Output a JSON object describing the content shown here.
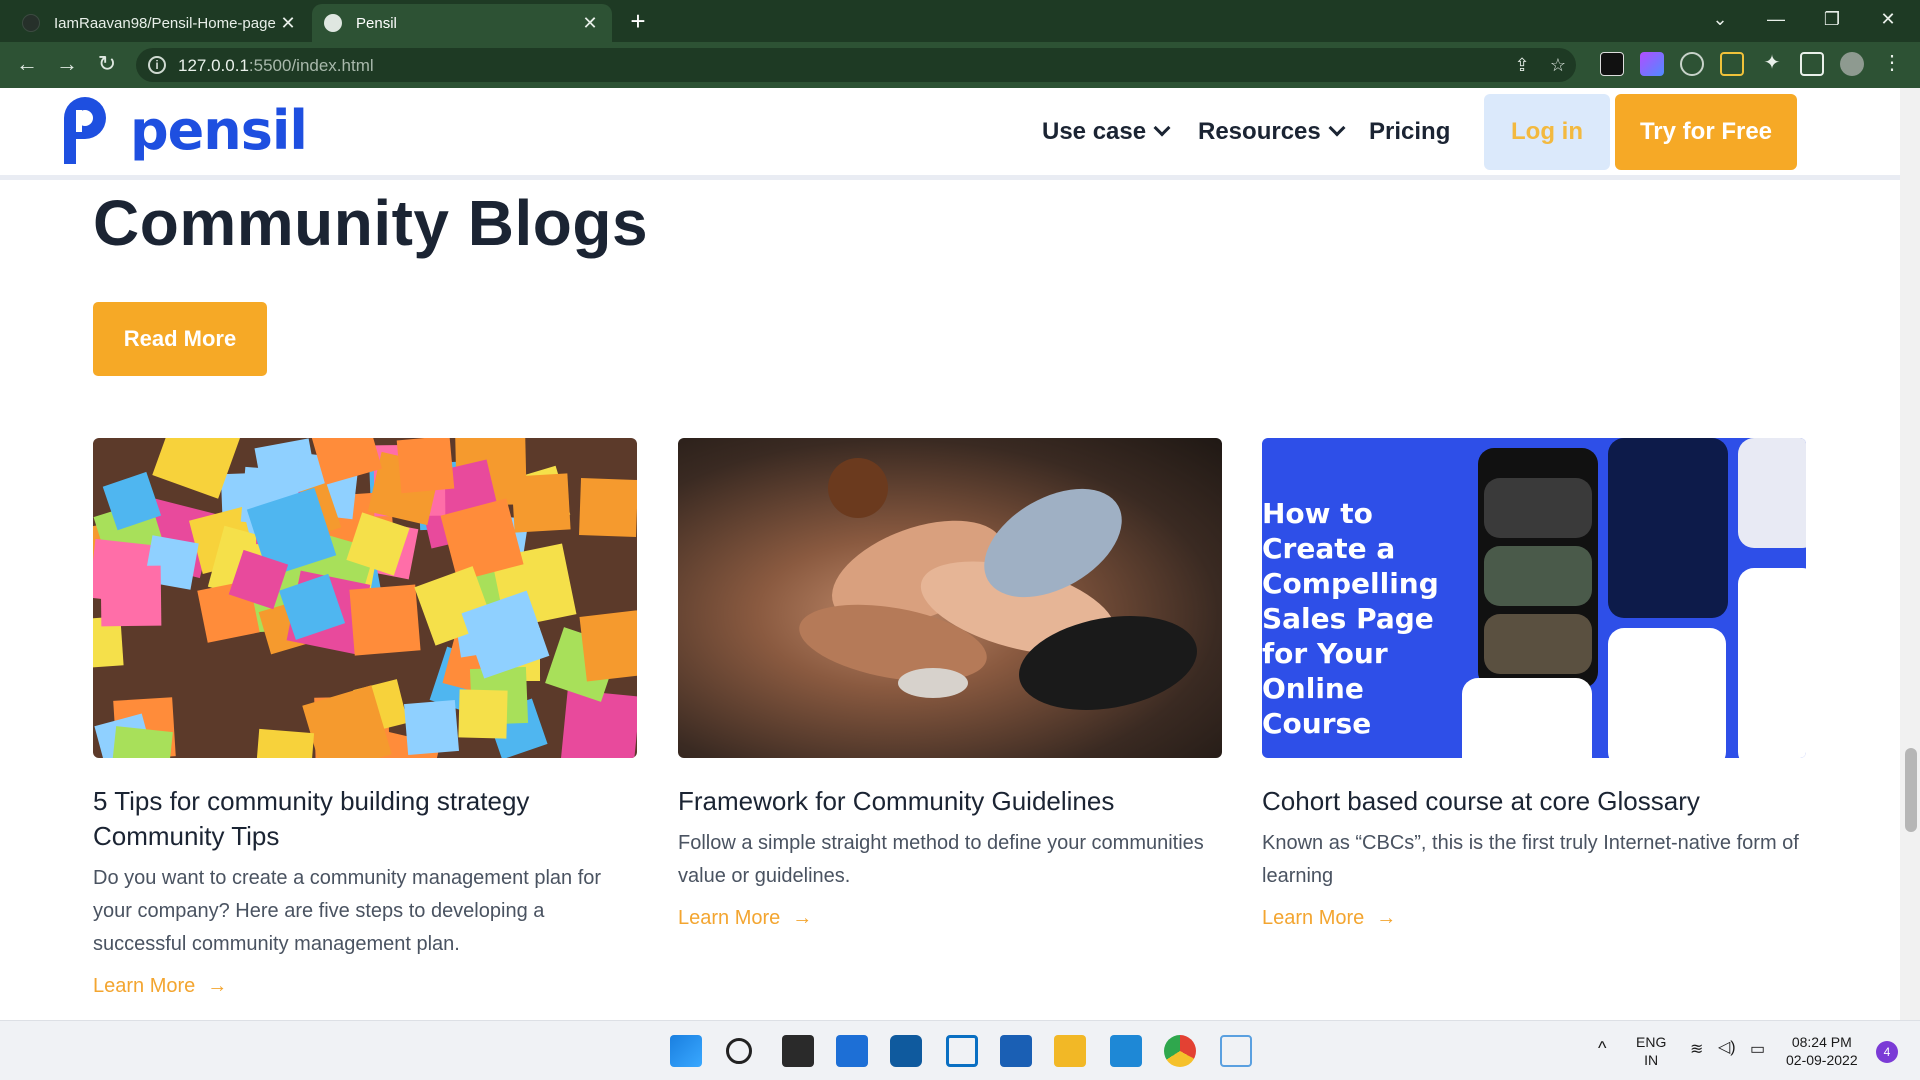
{
  "browser": {
    "tabs": [
      {
        "title": "IamRaavan98/Pensil-Home-page",
        "close": "✕"
      },
      {
        "title": "Pensil",
        "close": "✕"
      }
    ],
    "new_tab": "+",
    "url_main": "127.0.0.1",
    "url_rest": ":5500/index.html"
  },
  "site": {
    "logo_text": "pensil",
    "nav": {
      "use_case": "Use case",
      "resources": "Resources",
      "pricing": "Pricing"
    },
    "login": "Log in",
    "try_free": "Try for Free",
    "brand_color": "#1e4fe0",
    "accent_color": "#f6a926"
  },
  "section": {
    "heading": "Community Blogs",
    "read_more": "Read More"
  },
  "cards": [
    {
      "title": "5 Tips for community building strategy Community Tips",
      "desc": "Do you want to create a community management plan for your company? Here are five steps to developing a successful community management plan.",
      "learn": "Learn More"
    },
    {
      "title": "Framework for Community Guidelines",
      "desc": "Follow a simple straight method to define your communities value or guidelines.",
      "learn": "Learn More"
    },
    {
      "title": "Cohort based course at core Glossary",
      "desc": "Known as “CBCs”, this is the first truly Internet-native form of learning",
      "learn": "Learn More",
      "image_text": "How to Create a Compelling Sales Page for Your Online Course"
    }
  ],
  "taskbar": {
    "lang1": "ENG",
    "lang2": "IN",
    "time": "08:24 PM",
    "date": "02-09-2022",
    "badge": "4"
  }
}
